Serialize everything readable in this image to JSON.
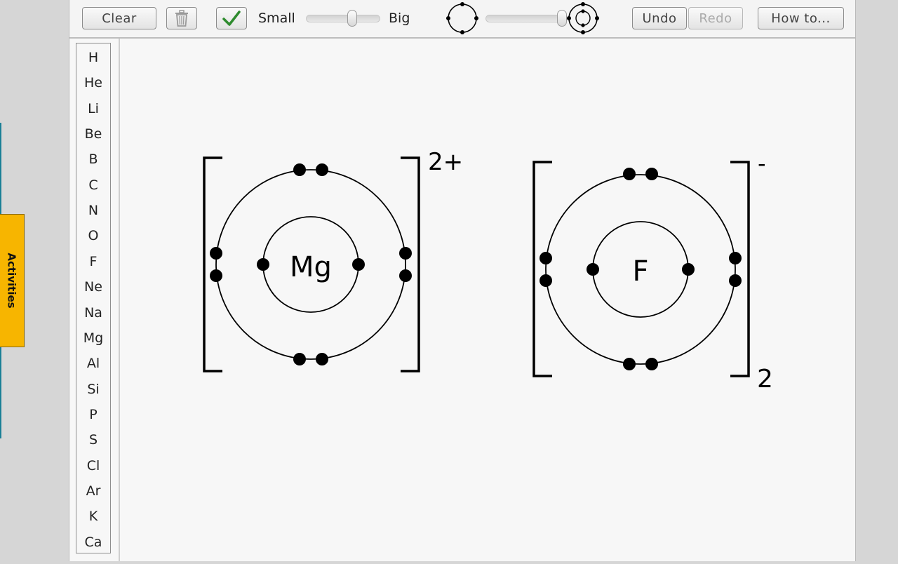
{
  "side_tab": {
    "label": "Activities"
  },
  "toolbar": {
    "clear_label": "Clear",
    "trash_icon": "trash-icon",
    "check_icon": "checkmark-icon",
    "size_small_label": "Small",
    "size_big_label": "Big",
    "size_slider_value": 0.64,
    "shell_slider_value": 1.0,
    "undo_label": "Undo",
    "redo_label": "Redo",
    "redo_enabled": false,
    "howto_label": "How to..."
  },
  "elements": [
    "H",
    "He",
    "Li",
    "Be",
    "B",
    "C",
    "N",
    "O",
    "F",
    "Ne",
    "Na",
    "Mg",
    "Al",
    "Si",
    "P",
    "S",
    "Cl",
    "Ar",
    "K",
    "Ca"
  ],
  "diagrams": [
    {
      "symbol": "Mg",
      "charge": "2+",
      "count": ""
    },
    {
      "symbol": "F",
      "charge": "-",
      "count": "2"
    }
  ],
  "colors": {
    "activities_tab": "#f7b500",
    "check": "#2e8b2e",
    "electron": "#000000"
  }
}
